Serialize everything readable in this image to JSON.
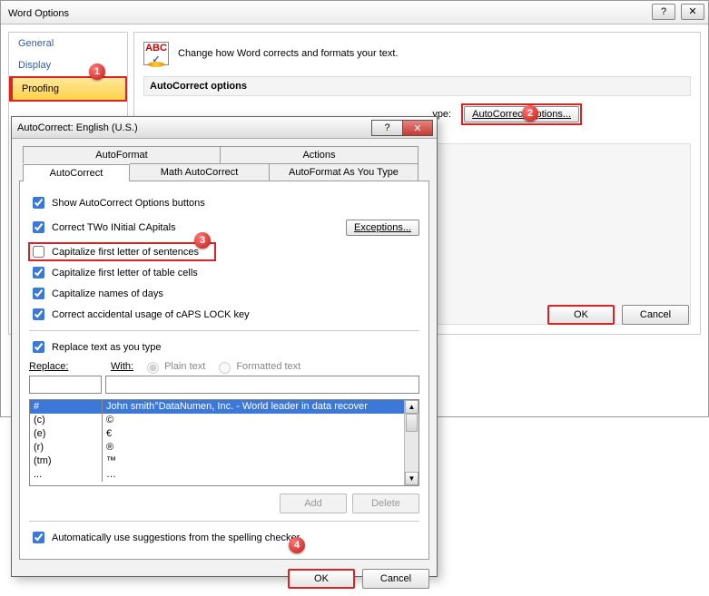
{
  "wordOptions": {
    "title": "Word Options",
    "nav": {
      "general": "General",
      "display": "Display",
      "proofing": "Proofing"
    },
    "headerText": "Change how Word corrects and formats your text.",
    "section1Label": "AutoCorrect options",
    "optionsRowLabel": "ype:",
    "optionsBtn": "AutoCorrect Options...",
    "ok": "OK",
    "cancel": "Cancel",
    "abc": "ABC"
  },
  "autoCorrect": {
    "title": "AutoCorrect: English (U.S.)",
    "tabs": {
      "autoformat": "AutoFormat",
      "actions": "Actions",
      "autocorrect": "AutoCorrect",
      "math": "Math AutoCorrect",
      "asyoutype": "AutoFormat As You Type"
    },
    "checks": {
      "showButtons": "Show AutoCorrect Options buttons",
      "twoInitial": "Correct TWo INitial CApitals",
      "capSentence": "Capitalize first letter of sentences",
      "capTable": "Capitalize first letter of table cells",
      "capDays": "Capitalize names of days",
      "capsLock": "Correct accidental usage of cAPS LOCK key",
      "replaceAsType": "Replace text as you type",
      "autoSuggest": "Automatically use suggestions from the spelling checker"
    },
    "exceptionsBtn": "Exceptions...",
    "replaceLabel": "Replace:",
    "withLabel": "With:",
    "plainText": "Plain text",
    "formattedText": "Formatted text",
    "addBtn": "Add",
    "deleteBtn": "Delete",
    "ok": "OK",
    "cancel": "Cancel",
    "table": [
      {
        "c1": "#",
        "c2": "John smith°DataNumen, Inc. - World leader in data recover"
      },
      {
        "c1": "(c)",
        "c2": "©"
      },
      {
        "c1": "(e)",
        "c2": "€"
      },
      {
        "c1": "(r)",
        "c2": "®"
      },
      {
        "c1": "(tm)",
        "c2": "™"
      },
      {
        "c1": "...",
        "c2": "…"
      }
    ]
  },
  "annotations": {
    "a1": "1",
    "a2": "2",
    "a3": "3",
    "a4": "4"
  }
}
